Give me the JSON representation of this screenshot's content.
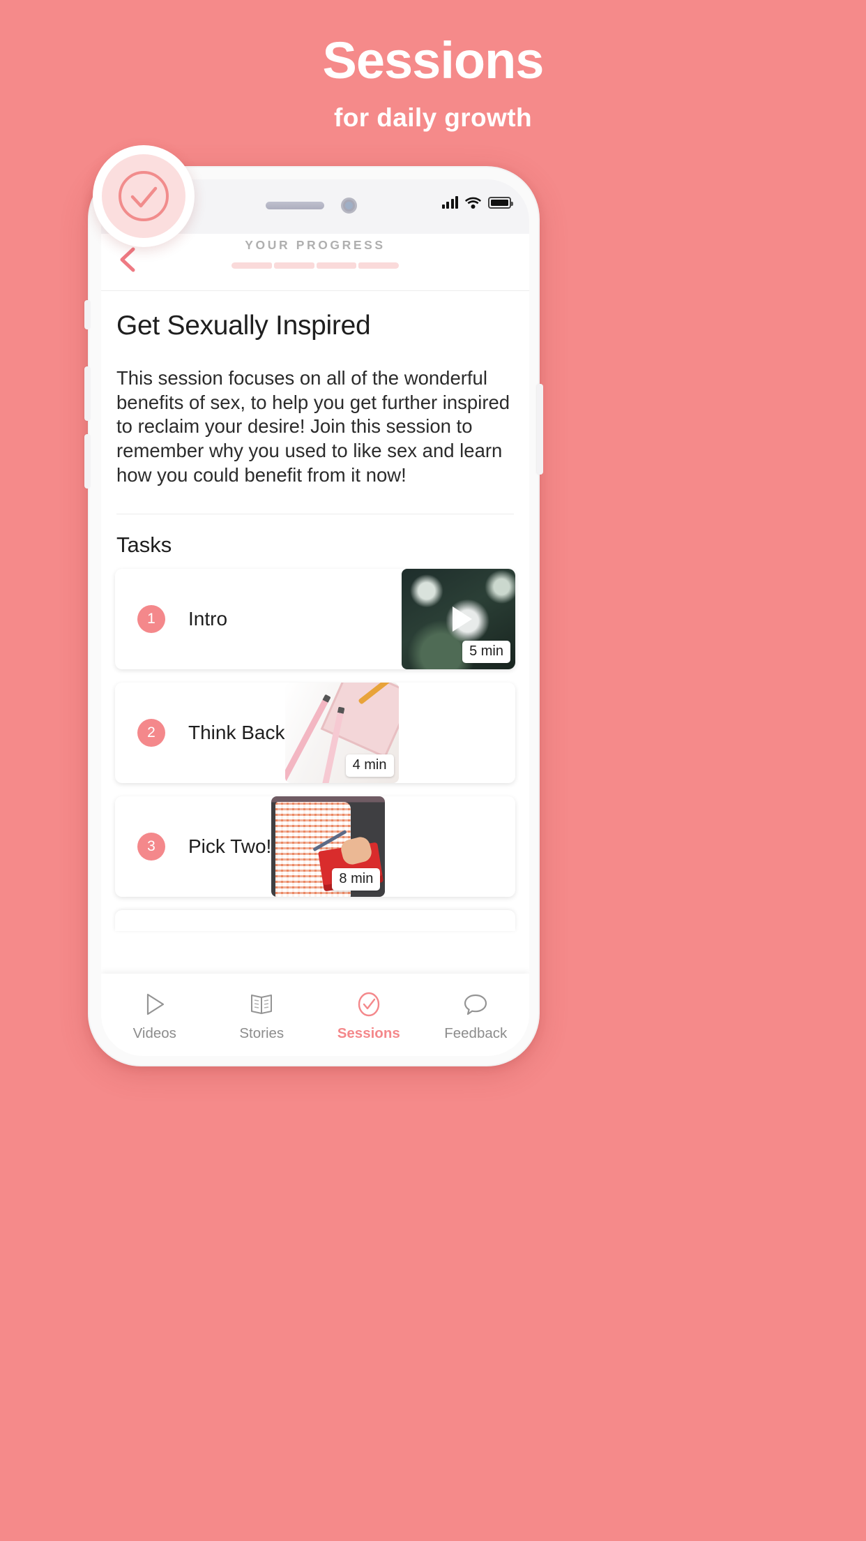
{
  "promo": {
    "title": "Sessions",
    "subtitle": "for daily growth",
    "background_color": "#F58A8A",
    "accent_color": "#F4888B"
  },
  "badge": {
    "icon": "check-circle-icon",
    "ring_color": "#FFFFFF",
    "fill_color": "#FBDEDE",
    "mark_color": "#F28B8B"
  },
  "status_bar": {
    "signal_icon": "cellular-signal-icon",
    "wifi_icon": "wifi-icon",
    "battery_icon": "battery-full-icon"
  },
  "nav": {
    "back_icon": "chevron-left-icon",
    "progress_label": "YOUR PROGRESS",
    "progress_segments": 4,
    "progress_segment_color": "#FADADA"
  },
  "session": {
    "title": "Get Sexually Inspired",
    "description": "This session focuses on all of the wonderful benefits of sex, to help you get further inspired to reclaim your desire! Join this session to remember why you used to like sex and learn how you could benefit from it now!"
  },
  "tasks": {
    "heading": "Tasks",
    "items": [
      {
        "number": "1",
        "label": "Intro",
        "duration": "5 min",
        "has_play": true,
        "thumb": "dark-floral-roses"
      },
      {
        "number": "2",
        "label": "Think Back",
        "duration": "4 min",
        "has_play": false,
        "thumb": "pink-pencils-paper"
      },
      {
        "number": "3",
        "label": "Pick Two!",
        "duration": "8 min",
        "has_play": false,
        "thumb": "woman-writing-notebook"
      }
    ]
  },
  "tab_bar": {
    "items": [
      {
        "label": "Videos",
        "icon": "play-outline-icon",
        "active": false
      },
      {
        "label": "Stories",
        "icon": "open-book-icon",
        "active": false
      },
      {
        "label": "Sessions",
        "icon": "check-circle-icon",
        "active": true
      },
      {
        "label": "Feedback",
        "icon": "speech-bubble-icon",
        "active": false
      }
    ]
  }
}
